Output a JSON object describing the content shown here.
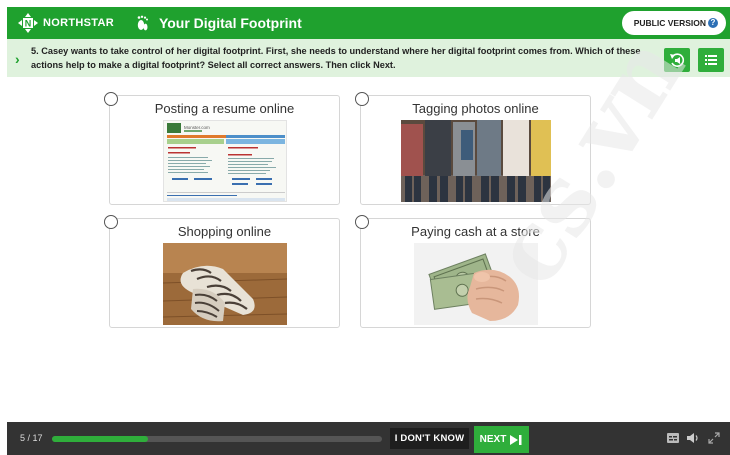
{
  "header": {
    "brand": "NORTHSTAR",
    "title": "Your Digital Footprint",
    "version_label": "PUBLIC VERSION",
    "help_icon": "?"
  },
  "question": {
    "text": "5. Casey wants to take control of her digital footprint. First, she needs to understand where her digital footprint comes from. Which of these actions help to make a digital footprint? Select all correct answers. Then click Next."
  },
  "options": [
    {
      "label": "Posting a resume online",
      "selected": false
    },
    {
      "label": "Tagging photos online",
      "selected": false
    },
    {
      "label": "Shopping online",
      "selected": false
    },
    {
      "label": "Paying cash at a store",
      "selected": false
    }
  ],
  "resume_thumb": {
    "site_name": "Monster.com"
  },
  "footer": {
    "progress_text": "5 / 17",
    "progress_fraction": 0.29,
    "idk_label": "I DON'T KNOW",
    "next_label": "NEXT"
  },
  "watermark": "cs.vn",
  "colors": {
    "brand_green": "#1fa12e",
    "button_green": "#2fae3b",
    "question_bg": "#dff2dd",
    "footer_bg": "#333333"
  }
}
